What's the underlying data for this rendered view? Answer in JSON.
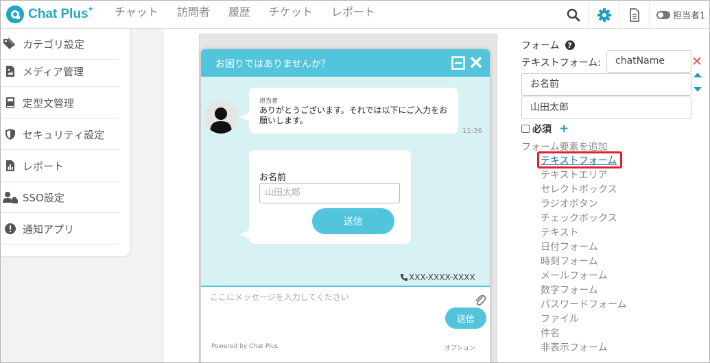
{
  "app": {
    "logo_text": "Chat Plus",
    "logo_sup": "+"
  },
  "nav": [
    "チャット",
    "訪問者",
    "履歴",
    "チケット",
    "レポート"
  ],
  "header": {
    "agent_label": "担当者1"
  },
  "sidebar": {
    "items": [
      {
        "label": "カテゴリ設定",
        "icon": "tags-icon"
      },
      {
        "label": "メディア管理",
        "icon": "image-file-icon"
      },
      {
        "label": "定型文管理",
        "icon": "book-icon"
      },
      {
        "label": "セキュリティ設定",
        "icon": "shield-icon"
      },
      {
        "label": "レポート",
        "icon": "report-chart-icon"
      },
      {
        "label": "SSO設定",
        "icon": "user-key-icon"
      },
      {
        "label": "通知アプリ",
        "icon": "alert-circle-icon"
      }
    ]
  },
  "chat": {
    "title": "お困りではありませんか？",
    "agent_name": "担当者",
    "message": "ありがとうございます。それでは以下にご入力をお願いします。",
    "time": "11:36",
    "form_label": "お名前",
    "form_placeholder": "山田太郎",
    "form_send": "送信",
    "phone": "XXX-XXXX-XXXX",
    "input_placeholder": "ここにメッセージを入力してください",
    "send": "送信",
    "powered_by": "Powered by Chat Plus",
    "option": "オプション"
  },
  "panel": {
    "title": "フォーム",
    "text_form_label": "テキストフォーム:",
    "name_value": "chatName",
    "label_value": "お名前",
    "placeholder_value": "山田太郎",
    "required_label": "必須",
    "add_title": "フォーム要素を追加",
    "add_items": [
      "テキストフォーム",
      "テキストエリア",
      "セレクトボックス",
      "ラジオボタン",
      "チェックボックス",
      "テキスト",
      "日付フォーム",
      "時刻フォーム",
      "メールフォーム",
      "数字フォーム",
      "パスワードフォーム",
      "ファイル",
      "件名",
      "非表示フォーム"
    ]
  },
  "colors": {
    "accent": "#52c4dc",
    "brand": "#23a6c4",
    "link": "#1d9ec0",
    "highlight": "#e0202a",
    "danger": "#e04848"
  }
}
